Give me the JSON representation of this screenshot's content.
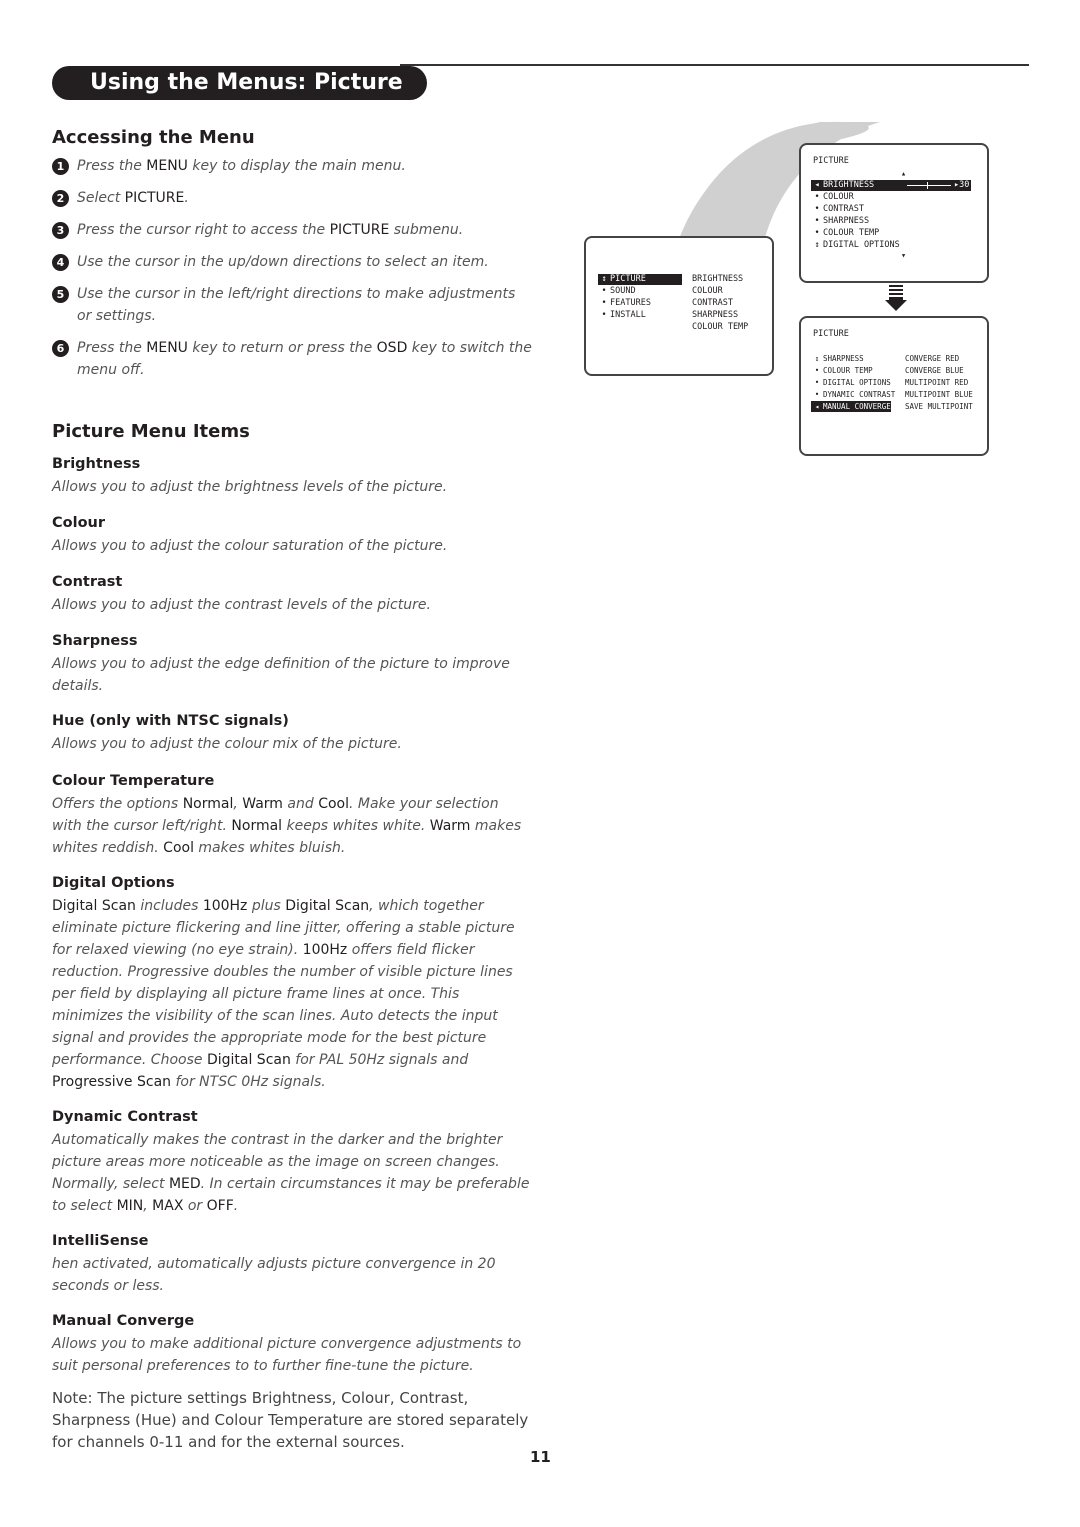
{
  "header": {
    "title": "Using the Menus: Picture"
  },
  "accessing": {
    "heading": "Accessing the Menu",
    "steps": [
      {
        "num": "1",
        "parts": [
          {
            "t": "Press the ",
            "k": false
          },
          {
            "t": "MENU",
            "k": true
          },
          {
            "t": " key to display the main menu.",
            "k": false
          }
        ]
      },
      {
        "num": "2",
        "parts": [
          {
            "t": "Select ",
            "k": false
          },
          {
            "t": "PICTURE",
            "k": true
          },
          {
            "t": ".",
            "k": false
          }
        ]
      },
      {
        "num": "3",
        "parts": [
          {
            "t": "Press the cursor right to access the ",
            "k": false
          },
          {
            "t": "PICTURE",
            "k": true
          },
          {
            "t": " submenu.",
            "k": false
          }
        ]
      },
      {
        "num": "4",
        "parts": [
          {
            "t": "Use the cursor in the up/down directions to select an item.",
            "k": false
          }
        ]
      },
      {
        "num": "5",
        "parts": [
          {
            "t": "Use the cursor in the left/right directions to make adjustments or settings.",
            "k": false
          }
        ]
      },
      {
        "num": "6",
        "parts": [
          {
            "t": "Press the ",
            "k": false
          },
          {
            "t": "MENU",
            "k": true
          },
          {
            "t": " key to return or press the ",
            "k": false
          },
          {
            "t": "OSD",
            "k": true
          },
          {
            "t": " key to switch the menu off.",
            "k": false
          }
        ]
      }
    ]
  },
  "items_section": {
    "heading": "Picture Menu Items",
    "items": [
      {
        "title": "Brightness",
        "parts": [
          {
            "t": "Allows you to adjust the brightness levels of the picture.",
            "k": false
          }
        ]
      },
      {
        "title": "Colour",
        "parts": [
          {
            "t": "Allows you to adjust the colour saturation of the picture.",
            "k": false
          }
        ]
      },
      {
        "title": "Contrast",
        "parts": [
          {
            "t": "Allows you to adjust the contrast levels of the picture.",
            "k": false
          }
        ]
      },
      {
        "title": "Sharpness",
        "parts": [
          {
            "t": "Allows you to adjust the edge definition of the picture to improve details.",
            "k": false
          }
        ]
      },
      {
        "title": "Hue (only with NTSC signals)",
        "parts": [
          {
            "t": "Allows you to adjust the colour mix of the picture.",
            "k": false
          }
        ]
      },
      {
        "title": "Colour Temperature",
        "parts": [
          {
            "t": "Offers the options ",
            "k": false
          },
          {
            "t": "Normal",
            "k": true
          },
          {
            "t": ", ",
            "k": false
          },
          {
            "t": "Warm",
            "k": true
          },
          {
            "t": " and ",
            "k": false
          },
          {
            "t": "Cool",
            "k": true
          },
          {
            "t": ". Make your selection with the cursor left/right. ",
            "k": false
          },
          {
            "t": "Normal",
            "k": true
          },
          {
            "t": " keeps whites white. ",
            "k": false
          },
          {
            "t": "Warm",
            "k": true
          },
          {
            "t": " makes whites reddish. ",
            "k": false
          },
          {
            "t": "Cool",
            "k": true
          },
          {
            "t": " makes whites bluish.",
            "k": false
          }
        ]
      },
      {
        "title": "Digital Options",
        "parts": [
          {
            "t": "Digital Scan",
            "k": true
          },
          {
            "t": " includes ",
            "k": false
          },
          {
            "t": "100Hz",
            "k": true
          },
          {
            "t": " plus ",
            "k": false
          },
          {
            "t": "Digital Scan",
            "k": true
          },
          {
            "t": ", which together eliminate picture flickering and line jitter, offering a stable picture for relaxed viewing (no eye strain). ",
            "k": false
          },
          {
            "t": "100Hz",
            "k": true
          },
          {
            "t": " offers field flicker reduction. Progressive doubles the number of visible picture lines per field by displaying all picture frame lines at once. This minimizes the visibility of the scan lines. Auto detects the input signal and provides the appropriate mode for the best picture performance. Choose ",
            "k": false
          },
          {
            "t": "Digital Scan",
            "k": true
          },
          {
            "t": " for PAL 50Hz signals and ",
            "k": false
          },
          {
            "t": "Progressive Scan",
            "k": true
          },
          {
            "t": " for NTSC  0Hz signals.",
            "k": false
          }
        ]
      },
      {
        "title": "Dynamic Contrast",
        "parts": [
          {
            "t": "Automatically makes the contrast in the darker and the brighter picture areas more noticeable as the image on screen changes. Normally, select ",
            "k": false
          },
          {
            "t": "MED",
            "k": true
          },
          {
            "t": ". In certain circumstances it may be preferable to select ",
            "k": false
          },
          {
            "t": "MIN",
            "k": true
          },
          {
            "t": ", ",
            "k": false
          },
          {
            "t": "MAX",
            "k": true
          },
          {
            "t": " or ",
            "k": false
          },
          {
            "t": "OFF",
            "k": true
          },
          {
            "t": ".",
            "k": false
          }
        ]
      },
      {
        "title": "IntelliSense",
        "parts": [
          {
            "t": "  hen activated, automatically adjusts picture convergence in 20 seconds or less.",
            "k": false
          }
        ]
      },
      {
        "title": "Manual Converge",
        "parts": [
          {
            "t": "Allows you to make additional picture convergence adjustments to suit personal preferences to to further fine-tune the picture.",
            "k": false
          }
        ]
      }
    ]
  },
  "note": "Note: The picture settings Brightness, Colour, Contrast, Sharpness (Hue) and Colour Temperature are stored separately for channels 0-11 and for the external sources.",
  "page_number": "11",
  "osd_main": {
    "left_items": [
      "PICTURE",
      "SOUND",
      "FEATURES",
      "INSTALL"
    ],
    "selected_index": 0,
    "right_items": [
      "BRIGHTNESS",
      "COLOUR",
      "CONTRAST",
      "SHARPNESS",
      "COLOUR TEMP"
    ]
  },
  "osd_picture": {
    "title": "PICTURE",
    "items": [
      "BRIGHTNESS",
      "COLOUR",
      "CONTRAST",
      "SHARPNESS",
      "COLOUR TEMP",
      "DIGITAL OPTIONS"
    ],
    "selected_index": 0,
    "slider_value": "30",
    "slider_fraction": 0.45
  },
  "osd_picture2": {
    "title": "PICTURE",
    "left_items": [
      "SHARPNESS",
      "COLOUR TEMP",
      "DIGITAL OPTIONS",
      "DYNAMIC CONTRAST",
      "MANUAL CONVERGE"
    ],
    "selected_index": 4,
    "right_items": [
      "CONVERGE RED",
      "CONVERGE BLUE",
      "MULTIPOINT RED",
      "MULTIPOINT BLUE",
      "SAVE MULTIPOINT"
    ]
  }
}
